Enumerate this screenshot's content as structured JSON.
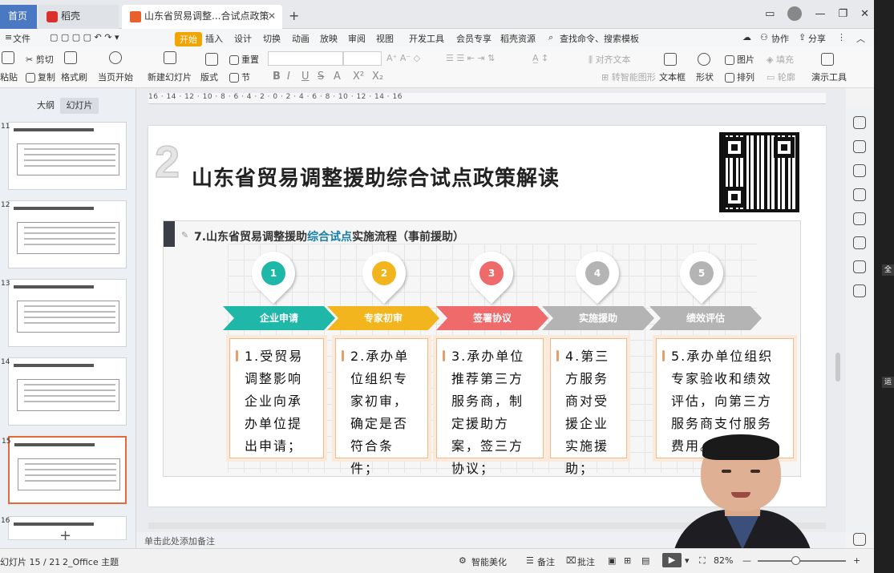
{
  "tabs": {
    "home": "首页",
    "wps": "稻壳",
    "doc": "山东省贸易调整...合试点政策宣讲"
  },
  "menu": {
    "file": "文件",
    "start": "开始",
    "insert": "插入",
    "design": "设计",
    "transition": "切换",
    "animation": "动画",
    "show": "放映",
    "review": "审阅",
    "view": "视图",
    "dev": "开发工具",
    "member": "会员专享",
    "template": "稻壳资源",
    "search": "查找命令、搜索模板",
    "collab": "协作",
    "share": "分享"
  },
  "ribbon": {
    "paste": "粘贴",
    "cut": "剪切",
    "copy": "复制",
    "format_painter": "格式刷",
    "from_start": "当页开始",
    "new_slide": "新建幻灯片",
    "layout": "版式",
    "section": "节",
    "reset": "重置",
    "text_direction": "文字方向",
    "align_text": "对齐文本",
    "smartart": "转智能图形",
    "textbox": "文本框",
    "shape": "形状",
    "picture": "图片",
    "fill": "填充",
    "arrange": "排列",
    "outline": "轮廓",
    "presenter_tools": "演示工具"
  },
  "left_panel": {
    "outline_tab": "大纲",
    "slides_tab": "幻灯片",
    "thumbs": [
      {
        "num": "11"
      },
      {
        "num": "12"
      },
      {
        "num": "13"
      },
      {
        "num": "14"
      },
      {
        "num": "15"
      },
      {
        "num": "16"
      }
    ]
  },
  "ruler_text": "16 · 14 · 12 · 10 · 8 · 6 · 4 · 2 · 0 · 2 · 4 · 6 · 8 · 10 · 12 · 14 · 16",
  "slide": {
    "number_glyph": "2",
    "title": "山东省贸易调整援助综合试点政策解读",
    "subtitle_prefix": "7.山东省贸易调整援助",
    "subtitle_highlight": "综合试点",
    "subtitle_suffix": "实施流程（事前援助）",
    "steps": [
      {
        "n": "1",
        "label": "企业申请",
        "color": "#1fb8a8",
        "text": "1.受贸易调整影响企业向承办单位提出申请；"
      },
      {
        "n": "2",
        "label": "专家初审",
        "color": "#f2b51d",
        "text": "2.承办单位组织专家初审，确定是否符合条件；"
      },
      {
        "n": "3",
        "label": "签署协议",
        "color": "#ef6a6a",
        "text": "3.承办单位推荐第三方服务商，制定援助方案，签三方协议；"
      },
      {
        "n": "4",
        "label": "实施援助",
        "color": "#b4b4b4",
        "text": "4.第三方服务商对受援企业实施援助；"
      },
      {
        "n": "5",
        "label": "绩效评估",
        "color": "#b4b4b4",
        "text": "5.承办单位组织专家验收和绩效评估，向第三方服务商支付服务费用。"
      }
    ]
  },
  "notes": "单击此处添加备注",
  "status": {
    "slide_counter": "幻灯片 15 / 21",
    "theme": "2_Office 主题",
    "beautify": "智能美化",
    "notes_btn": "备注",
    "comments": "批注",
    "zoom": "82%"
  },
  "right_strip": [
    "全",
    "运"
  ]
}
